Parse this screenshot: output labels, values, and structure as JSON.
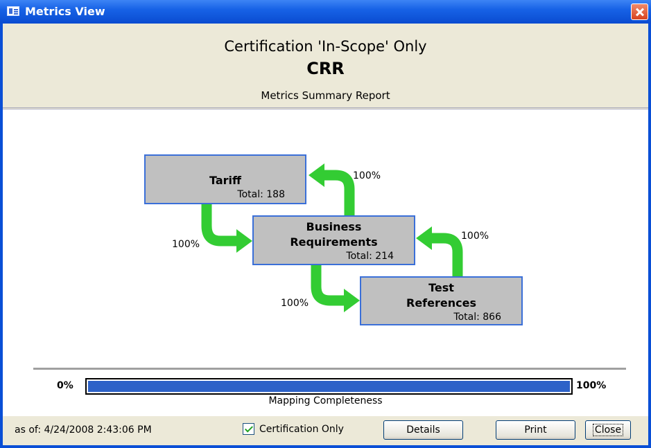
{
  "window": {
    "title": "Metrics View"
  },
  "header": {
    "line1": "Certification 'In-Scope' Only",
    "line2": "CRR",
    "line3": "Metrics Summary Report"
  },
  "diagram": {
    "boxes": [
      {
        "name": "Tariff",
        "total": "Total: 188"
      },
      {
        "name_line1": "Business",
        "name_line2": "Requirements",
        "total": "Total: 214"
      },
      {
        "name_line1": "Test",
        "name_line2": "References",
        "total": "Total: 866"
      }
    ],
    "percentages": {
      "business_to_tariff": "100%",
      "tariff_to_business": "100%",
      "test_to_business": "100%",
      "business_to_test": "100%"
    },
    "arrow_color": "#33cc33",
    "box_border_color": "#3a6fd8"
  },
  "progress": {
    "min_label": "0%",
    "max_label": "100%",
    "value_fraction": 1.0,
    "label": "Mapping Completeness",
    "fill_color": "#2d62c8"
  },
  "status": {
    "as_of": "as of:  4/24/2008 2:43:06 PM",
    "certification_only_label": "Certification Only",
    "certification_only_checked": true,
    "details_label": "Details",
    "print_label": "Print",
    "close_label": "Close"
  }
}
